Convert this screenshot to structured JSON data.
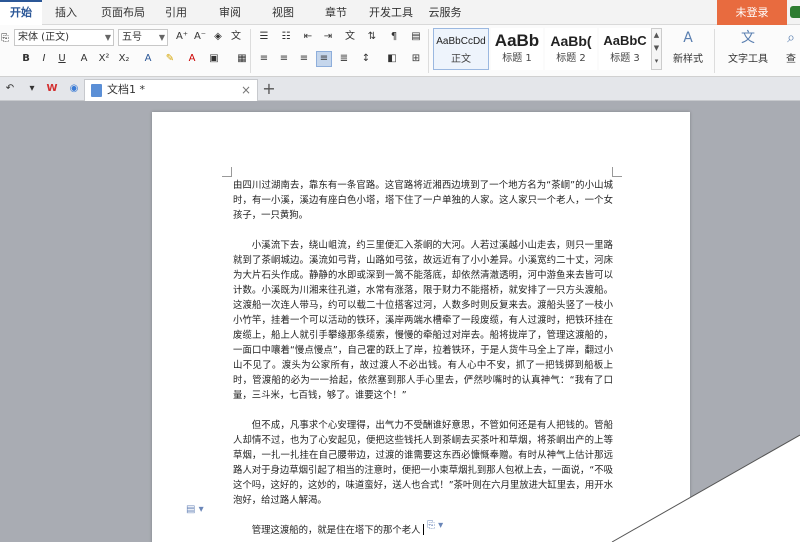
{
  "menu": {
    "tabs": [
      "开始",
      "插入",
      "页面布局",
      "引用",
      "审阅",
      "视图",
      "章节",
      "开发工具",
      "云服务"
    ],
    "login": "未登录"
  },
  "ribbon": {
    "font_name": "宋体 (正文)",
    "font_size": "五号",
    "styles": [
      {
        "sample": "AaBbCcDd",
        "name": "正文"
      },
      {
        "sample": "AaBb",
        "name": "标题 1"
      },
      {
        "sample": "AaBb(",
        "name": "标题 2"
      },
      {
        "sample": "AaBbC",
        "name": "标题 3"
      }
    ],
    "new_style": "新样式",
    "text_tools": "文字工具",
    "find_partial": "查"
  },
  "tabbar": {
    "doc_name": "文档1 *",
    "close": "×",
    "plus": "+"
  },
  "document": {
    "paragraphs": [
      "由四川过湖南去，靠东有一条官路。这官路将近湘西边境到了一个地方名为“茶峒”的小山城时，有一小溪，溪边有座白色小塔，塔下住了一户单独的人家。这人家只一个老人，一个女孩子，一只黄狗。",
      "小溪流下去，绕山岨流，约三里便汇入茶峒的大河。人若过溪越小山走去，则只一里路就到了茶峒城边。溪流如弓背，山路如弓弦，故远近有了小小差异。小溪宽约二十丈，河床为大片石头作成。静静的水即或深到一篙不能落底，却依然清澈透明，河中游鱼来去皆可以计数。小溪既为川湘来往孔道，水常有涨落，限于财力不能搭桥，就安排了一只方头渡船。这渡船一次连人带马，约可以载二十位搭客过河，人数多时则反复来去。渡船头竖了一枝小小竹竿，挂着一个可以活动的铁环，溪岸两端水槽牵了一段废缆，有人过渡时，把铁环挂在废缆上，船上人就引手攀缘那条缆索，慢慢的牵船过对岸去。船将拢岸了，管理这渡船的，一面口中嚷着“慢点慢点”，自己霍的跃上了岸，拉着铁环，于是人货牛马全上了岸，翻过小山不见了。渡头为公家所有，故过渡人不必出钱。有人心中不安，抓了一把钱掷到船板上时，管渡船的必为一一拾起，依然塞到那人手心里去，俨然吵嘴时的认真神气：“我有了口量，三斗米，七百钱，够了。谁要这个！”",
      "但不成，凡事求个心安理得，出气力不受酬谁好意思，不管如何还是有人把钱的。管船人却情不过，也为了心安起见，便把这些钱托人到茶峒去买茶叶和草烟，将茶峒出产的上等草烟，一扎一扎挂在自己腰带边，过渡的谁需要这东西必慷慨奉赠。有时从神气上估计那远路人对于身边草烟引起了相当的注意时，便把一小束草烟扎到那人包袱上去，一面说，“不吸这个吗，这好的，这妙的，味道蛮好，送人也合式！”茶叶则在六月里放进大缸里去，用开水泡好，给过路人解渴。"
    ],
    "typing_line": "管理这渡船的，就是住在塔下的那个老人"
  }
}
